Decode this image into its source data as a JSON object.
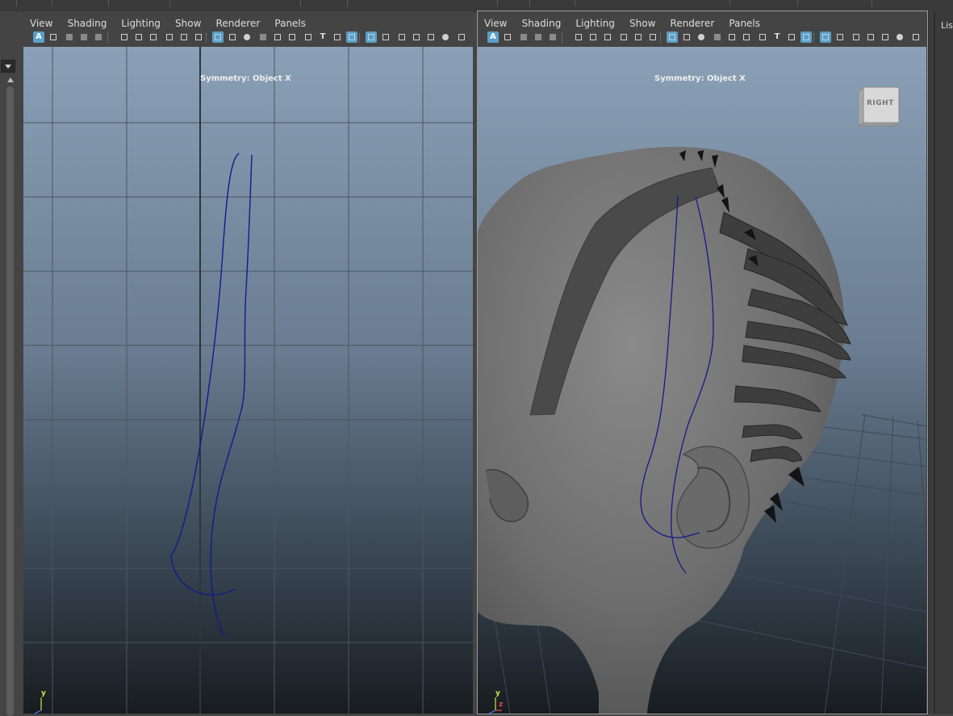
{
  "menus": [
    "View",
    "Shading",
    "Lighting",
    "Show",
    "Renderer",
    "Panels"
  ],
  "hud_text": "Symmetry: Object X",
  "viewcube_label": "RIGHT",
  "right_panel_label": "List",
  "axis": {
    "y": "y",
    "z": "z"
  },
  "icons": [
    "select-camera-icon",
    "lock-camera-icon",
    "bookmark-icon",
    "image-plane-icon",
    "2d-pan-zoom-icon",
    "grease-pencil-icon",
    "grid-icon",
    "film-gate-icon",
    "resolution-gate-icon",
    "gate-mask-icon",
    "field-chart-icon",
    "safe-action-icon",
    "safe-title-icon",
    "wireframe-icon",
    "smooth-shade-icon",
    "wireframe-on-shaded-icon",
    "textured-icon",
    "use-all-lights-icon",
    "shadows-icon"
  ],
  "colors": {
    "curve": "#141a8c",
    "viewport_top": "#8aa0b6",
    "viewport_bottom": "#181c20",
    "active_icon": "#5aa0c8"
  }
}
